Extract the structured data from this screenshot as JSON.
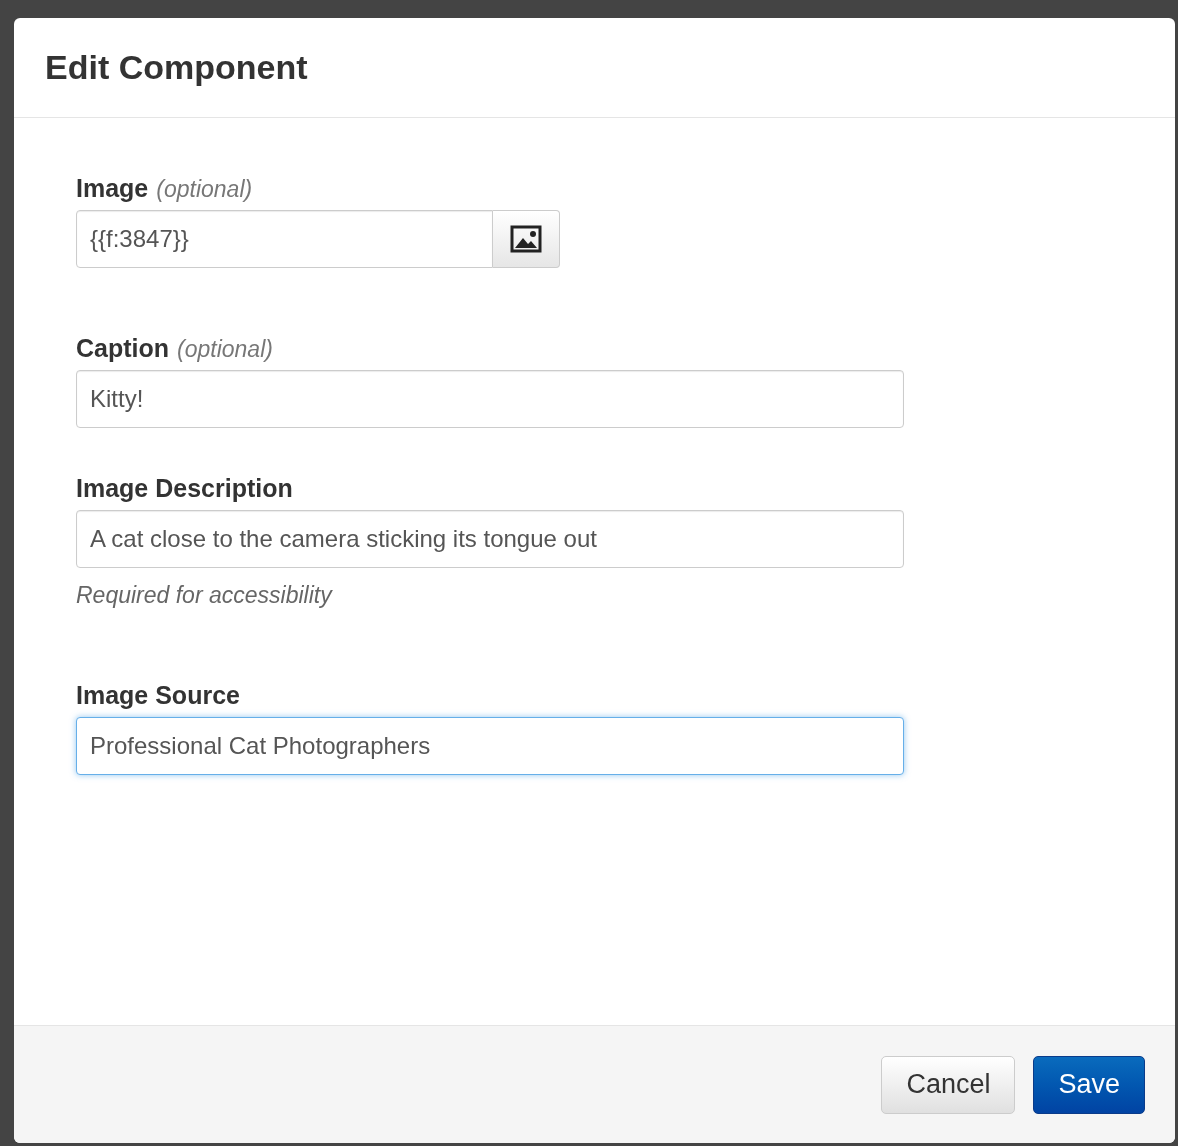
{
  "dialog": {
    "title": "Edit Component"
  },
  "fields": [
    {
      "kind": "file",
      "label": "Image",
      "note": "(optional)",
      "value": "{{f:3847}}",
      "focused": false
    },
    {
      "kind": "text",
      "label": "Caption",
      "note": "(optional)",
      "value": "Kitty!",
      "focused": false
    },
    {
      "kind": "text",
      "label": "Image Description",
      "value": "A cat close to the camera sticking its tongue out",
      "help": "Required for accessibility",
      "focused": false
    },
    {
      "kind": "text",
      "label": "Image Source",
      "value": "Professional Cat Photographers",
      "focused": true
    }
  ],
  "buttons": [
    {
      "label": "Cancel",
      "kind": "default"
    },
    {
      "label": "Save",
      "kind": "primary"
    }
  ]
}
